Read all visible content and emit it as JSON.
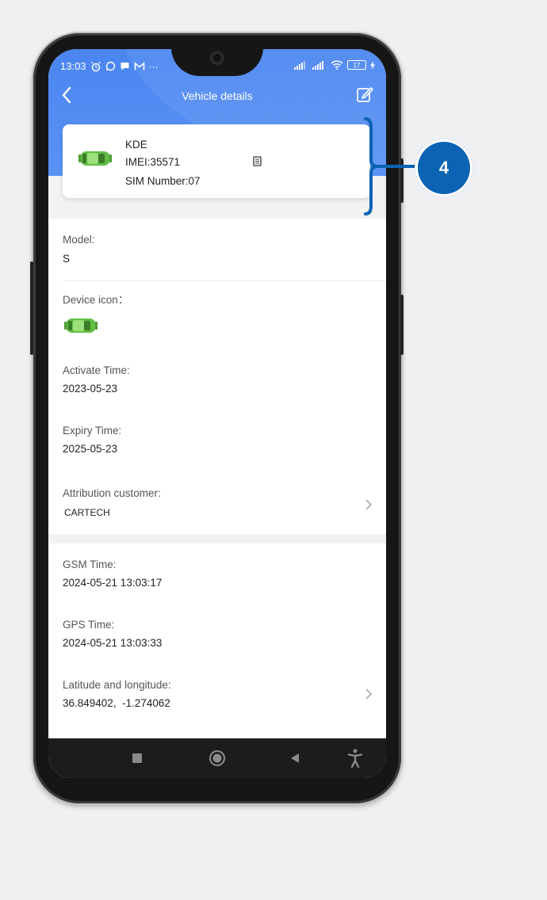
{
  "status_bar": {
    "time": "13:03",
    "battery": "17"
  },
  "header": {
    "title": "Vehicle details"
  },
  "device_card": {
    "name": "KDE",
    "imei": "IMEI:35571",
    "sim": "SIM Number:07"
  },
  "details": {
    "model_label": "Model:",
    "model_value": "S",
    "device_icon_label": "Device icon：",
    "activate_label": "Activate Time:",
    "activate_value": "2023-05-23",
    "expiry_label": "Expiry Time:",
    "expiry_value": "2025-05-23",
    "customer_label": "Attribution customer:",
    "customer_value": "CARTECH"
  },
  "gps": {
    "gsm_label": "GSM Time:",
    "gsm_value": "2024-05-21 13:03:17",
    "gps_label": "GPS Time:",
    "gps_value": "2024-05-21 13:03:33",
    "latlng_label": "Latitude and longitude:",
    "latlng_value": "36.849402,  -1.274062"
  },
  "callout": {
    "number": "4"
  },
  "colors": {
    "header_blue": "#4a85f0",
    "badge_blue": "#0c63b3",
    "car_green": "#66c44a"
  }
}
